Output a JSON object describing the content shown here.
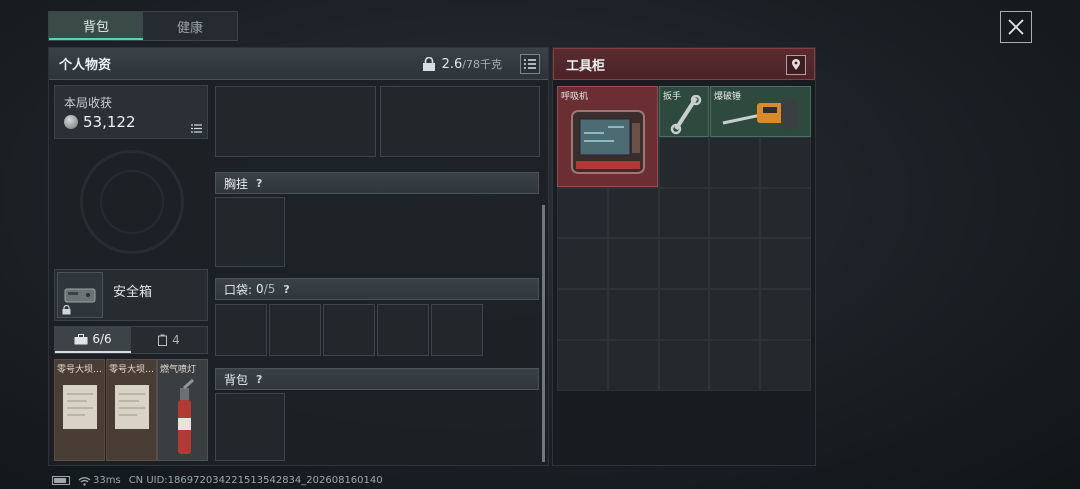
{
  "tabs": [
    {
      "label": "背包",
      "active": true
    },
    {
      "label": "健康",
      "active": false
    }
  ],
  "personal": {
    "title": "个人物资",
    "weight_value": "2.6",
    "weight_max": "/78千克",
    "earnings_label": "本局收获",
    "earnings_value": "53,122",
    "safebox_label": "安全箱"
  },
  "subtabs": [
    {
      "label": "6/6",
      "active": true
    },
    {
      "label": "4",
      "active": false
    }
  ],
  "mini_items": [
    "零号大坝…",
    "零号大坝…",
    "燃气喷灯"
  ],
  "sections": {
    "chest": {
      "label": "胸挂",
      "help": "?"
    },
    "pocket": {
      "label": "口袋:",
      "count": "0",
      "max": "/5",
      "help": "?"
    },
    "backpack": {
      "label": "背包",
      "help": "?"
    }
  },
  "cabinet": {
    "title": "工具柜",
    "items": [
      "呼吸机",
      "扳手",
      "爆破锤"
    ]
  },
  "footer": {
    "ping": "33ms",
    "uid": "CN UID:1869720342215135428​34_202608160140"
  },
  "colors": {
    "accent": "#57d4b5",
    "cabinet_header": "#5a2b2f",
    "respirator_bg": "#6b2f33",
    "tool_bg": "#2e4a3e"
  }
}
